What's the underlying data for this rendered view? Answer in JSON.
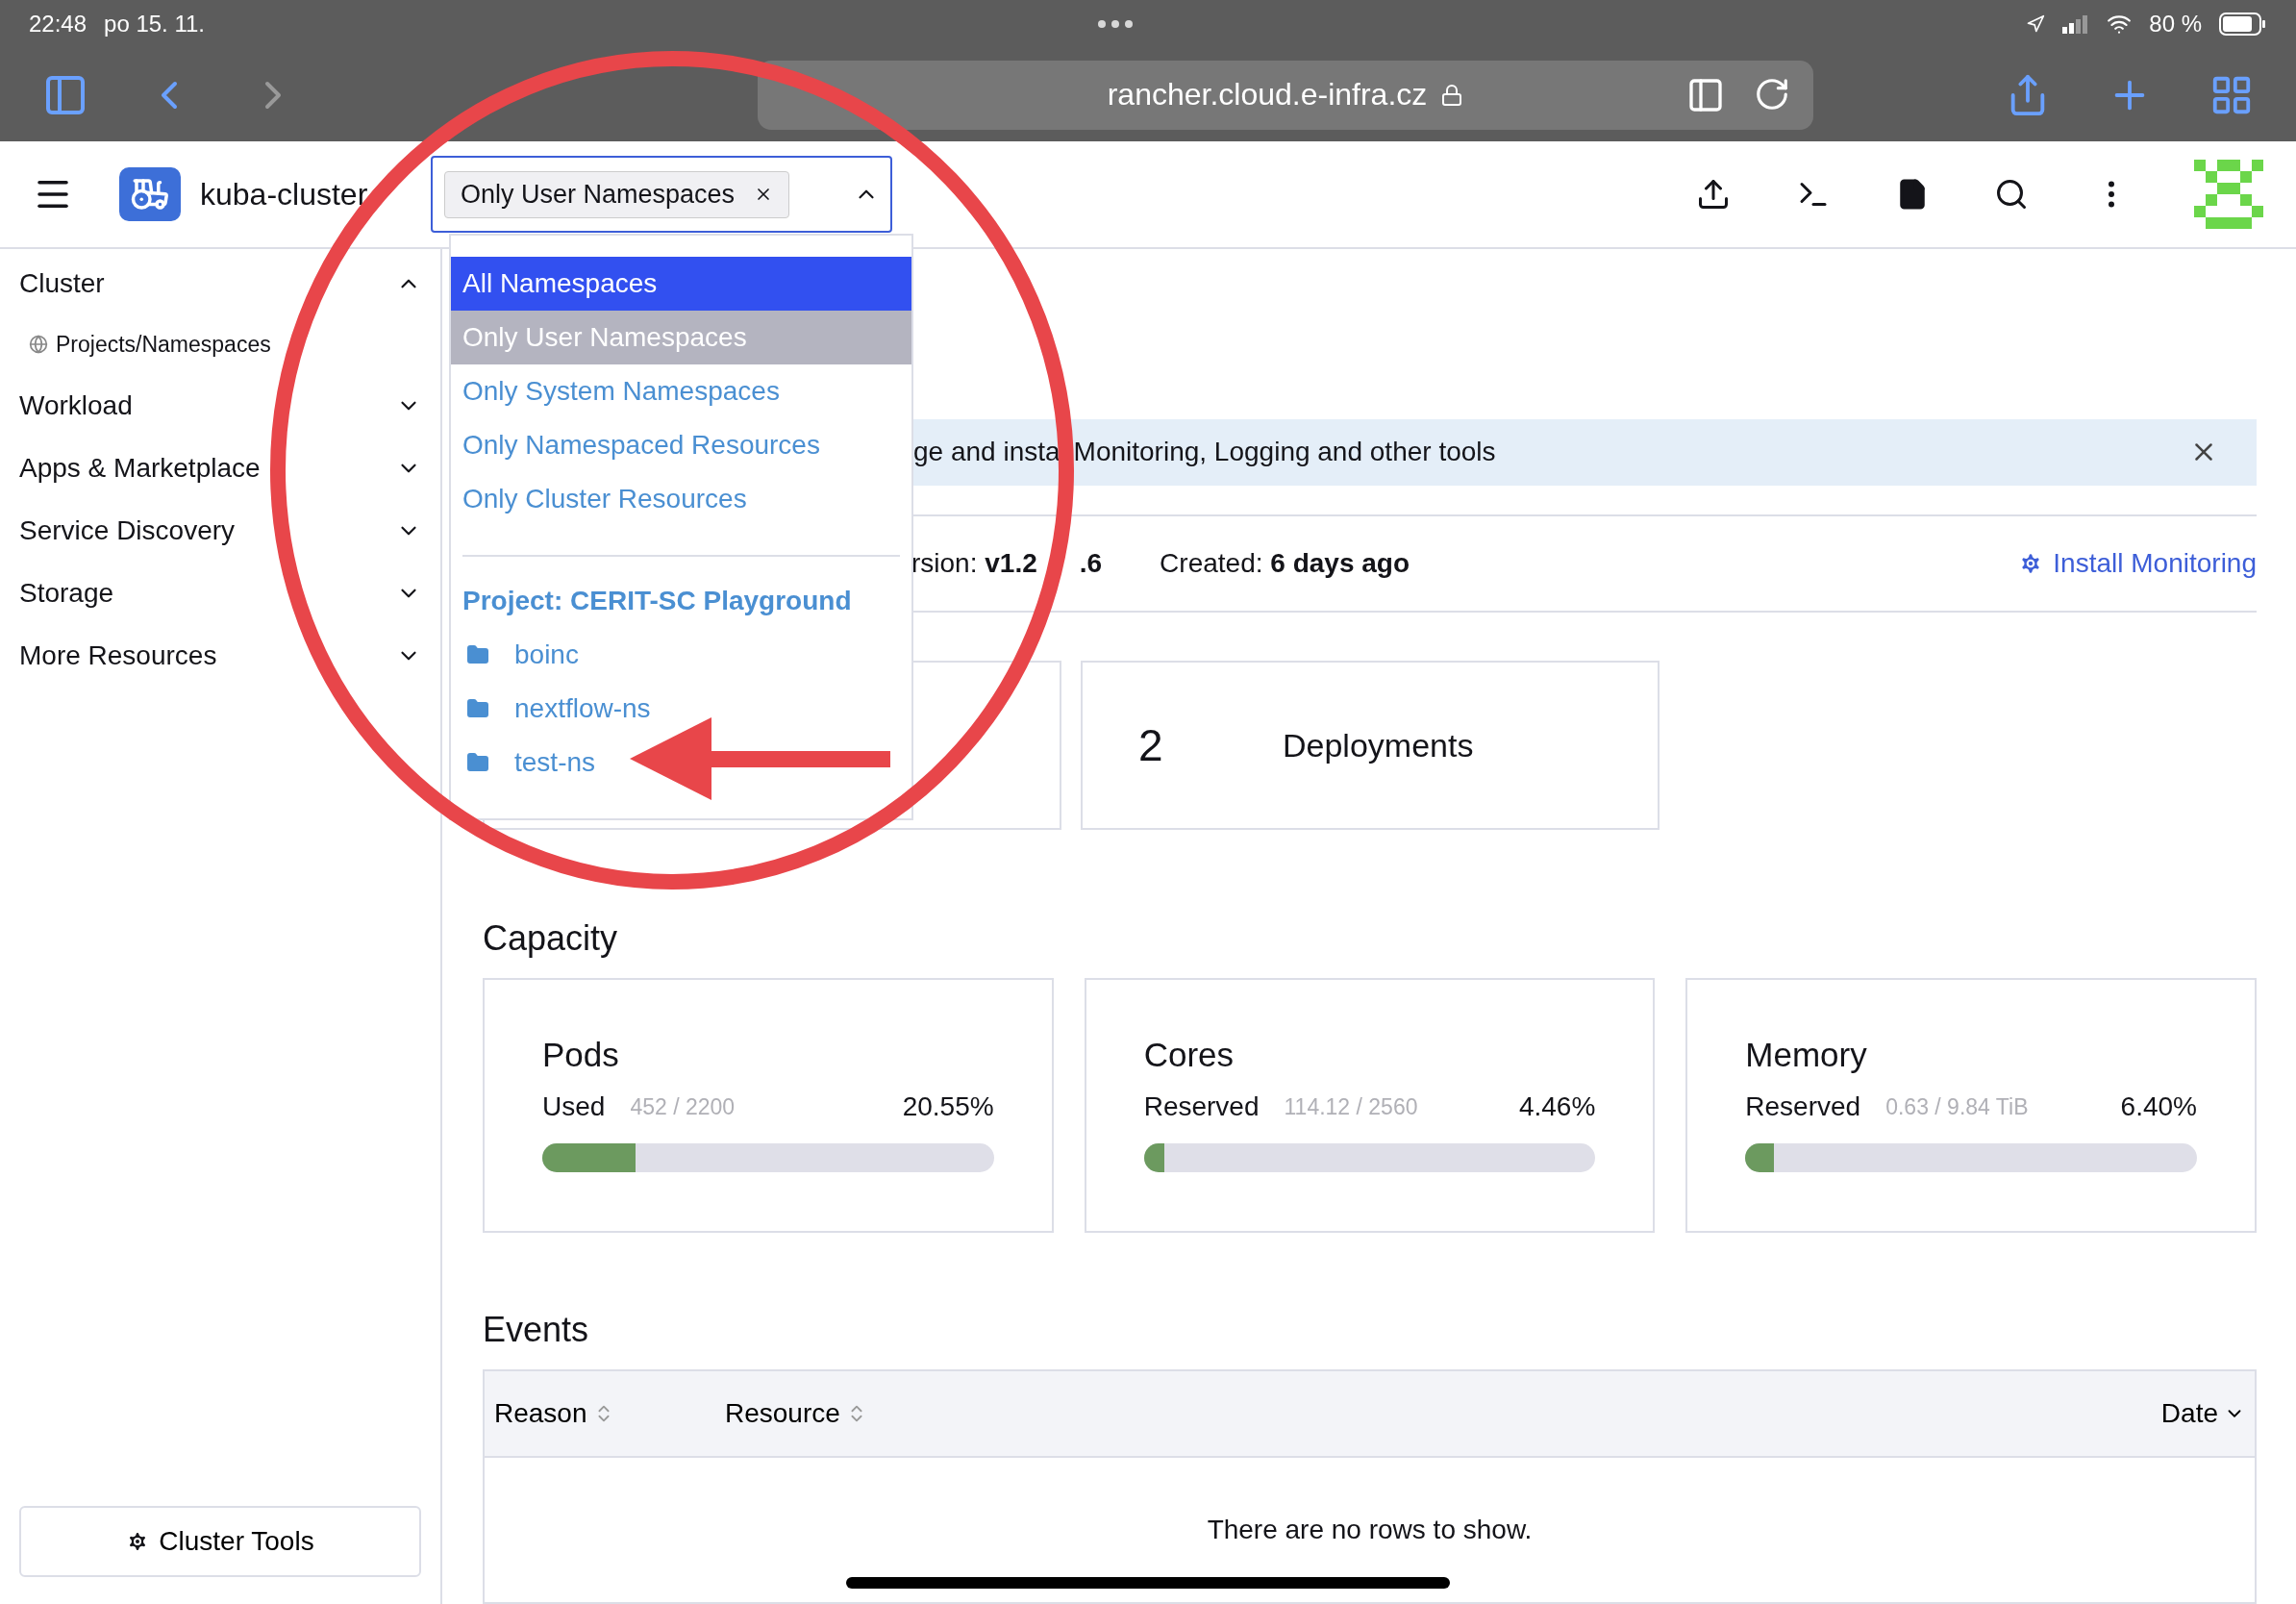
{
  "status_bar": {
    "time": "22:48",
    "date": "po 15. 11.",
    "battery": "80 %"
  },
  "browser": {
    "url": "rancher.cloud.e-infra.cz"
  },
  "header": {
    "cluster_name": "kuba-cluster",
    "namespace_filter": {
      "chip": "Only User Namespaces",
      "expanded": true
    }
  },
  "namespace_menu": {
    "options": [
      {
        "label": "All Namespaces",
        "highlighted": true,
        "selected": false
      },
      {
        "label": "Only User Namespaces",
        "highlighted": false,
        "selected": true
      },
      {
        "label": "Only System Namespaces",
        "highlighted": false,
        "selected": false
      },
      {
        "label": "Only Namespaced Resources",
        "highlighted": false,
        "selected": false
      },
      {
        "label": "Only Cluster Resources",
        "highlighted": false,
        "selected": false
      }
    ],
    "project": {
      "label": "Project: CERIT-SC Playground",
      "namespaces": [
        "boinc",
        "nextflow-ns",
        "test-ns"
      ]
    }
  },
  "sidebar": {
    "items": [
      {
        "label": "Cluster",
        "expanded": true,
        "children": [
          {
            "label": "Projects/Namespaces"
          }
        ]
      },
      {
        "label": "Workload",
        "expanded": false
      },
      {
        "label": "Apps & Marketplace",
        "expanded": false
      },
      {
        "label": "Service Discovery",
        "expanded": false
      },
      {
        "label": "Storage",
        "expanded": false
      },
      {
        "label": "More Resources",
        "expanded": false
      }
    ],
    "footer_button": "Cluster Tools"
  },
  "banner": {
    "text_start": "ge and insta",
    "text_end": "Monitoring, Logging and other tools"
  },
  "cluster_info": {
    "version": "rsion: **v1.2**",
    "version_tail": ".6",
    "created": "Created: **6 days ago**",
    "action": "Install Monitoring"
  },
  "counts": [
    {
      "value": "2",
      "label": "Deployments"
    }
  ],
  "capacity": {
    "title": "Capacity",
    "gauges": [
      {
        "title": "Pods",
        "label": "Used",
        "detail": "452 / 2200",
        "percent": "20.55%",
        "level": 0.2055
      },
      {
        "title": "Cores",
        "label": "Reserved",
        "detail": "114.12 / 2560",
        "percent": "4.46%",
        "level": 0.0446
      },
      {
        "title": "Memory",
        "label": "Reserved",
        "detail": "0.63 / 9.84 TiB",
        "percent": "6.40%",
        "level": 0.064
      }
    ]
  },
  "events": {
    "title": "Events",
    "columns": [
      {
        "label": "Reason",
        "sorted": false
      },
      {
        "label": "Resource",
        "sorted": false
      },
      {
        "label": "Date",
        "sorted": true
      }
    ],
    "empty_text": "There are no rows to show."
  }
}
